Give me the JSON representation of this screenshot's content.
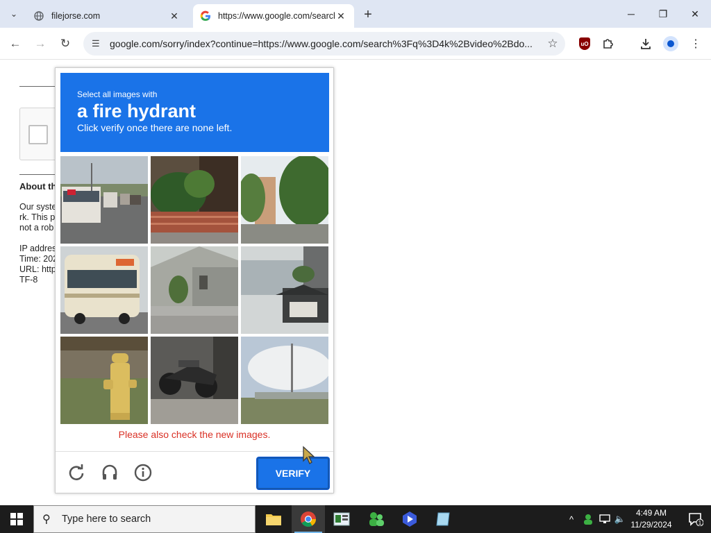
{
  "browser": {
    "tabs": [
      {
        "title": "filejorse.com",
        "favicon": "globe-icon",
        "active": false
      },
      {
        "title": "https://www.google.com/search",
        "favicon": "google-icon",
        "active": true
      }
    ],
    "address": "google.com/sorry/index?continue=https://www.google.com/search%3Fq%3D4k%2Bvideo%2Bdo..."
  },
  "background": {
    "heading": "About th",
    "lines_1": [
      "Our syste",
      "rk. This p",
      "not a rob"
    ],
    "lines_2": [
      "IP addres",
      "Time: 202",
      "URL: http",
      "TF-8"
    ]
  },
  "captcha": {
    "instruction_small": "Select all images with",
    "instruction_big": "a fire hydrant",
    "instruction_sub": "Click verify once there are none left.",
    "tiles": [
      "buses on road",
      "plants by red fence",
      "trees and building",
      "tram",
      "house with fence",
      "houses on hill",
      "yellow fire hydrant",
      "parked motorcycles",
      "sky and street lamp"
    ],
    "error": "Please also check the new images.",
    "verify_label": "VERIFY",
    "icons": [
      "reload-icon",
      "headphones-icon",
      "info-icon"
    ],
    "colors": {
      "accent": "#1a73e8",
      "error": "#d93025"
    }
  },
  "taskbar": {
    "search_placeholder": "Type here to search",
    "time": "4:49 AM",
    "date": "11/29/2024",
    "notification_count": "1"
  }
}
